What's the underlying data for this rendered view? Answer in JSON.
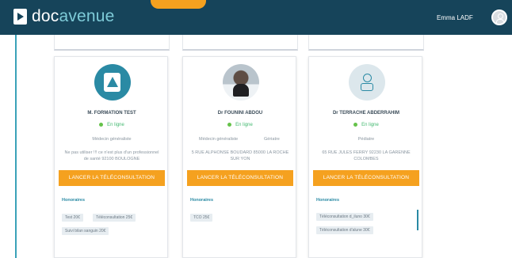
{
  "brand": {
    "prefix": "doc",
    "suffix": "avenue"
  },
  "user": {
    "name": "Emma LADF"
  },
  "doctors": [
    {
      "name": "M. FORMATION TEST",
      "status": "En ligne",
      "specialties": [
        "Médecin généraliste"
      ],
      "address": "Ne pas utiliser !!! ce n'est plus d'un professionnel de santé 92100 BOULOGNE",
      "cta": "LANCER LA TÉLÉCONSULTATION",
      "fees_title": "Honoraires",
      "fees": [
        "Test 20€",
        "Téléconsultation 25€",
        "Suivi bilan sanguin 20€"
      ]
    },
    {
      "name": "Dr FOUNINI ABDOU",
      "status": "En ligne",
      "specialties": [
        "Médecin généraliste",
        "Gériatre"
      ],
      "address": "5 RUE ALPHONSE BOUDARD 85000 LA ROCHE SUR YON",
      "cta": "LANCER LA TÉLÉCONSULTATION",
      "fees_title": "Honoraires",
      "fees": [
        "TCO 25€"
      ]
    },
    {
      "name": "Dr TERRACHE ABDERRAHIM",
      "status": "En ligne",
      "specialties": [
        "Pédiatre"
      ],
      "address": "65 RUE JULES FERRY 92230 LA GARENNE COLOMBES",
      "cta": "LANCER LA TÉLÉCONSULTATION",
      "fees_title": "Honoraires",
      "fees": [
        "Téléconsultation d_iluno 30€",
        "Téléconsultation d'alune 30€"
      ]
    }
  ]
}
